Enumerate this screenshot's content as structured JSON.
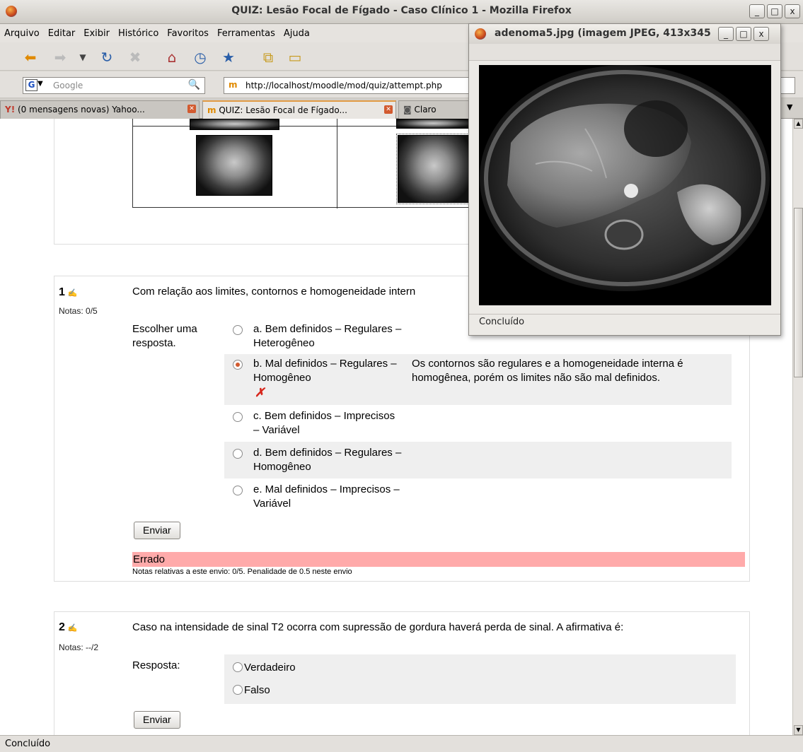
{
  "window": {
    "title": "QUIZ: Lesão Focal de Fígado - Caso Clínico 1 - Mozilla Firefox",
    "min_label": "_",
    "max_label": "□",
    "close_label": "x"
  },
  "menu": [
    "Arquivo",
    "Editar",
    "Exibir",
    "Histórico",
    "Favoritos",
    "Ferramentas",
    "Ajuda"
  ],
  "toolbar": {
    "back_icon": "back-arrow-icon",
    "forward_icon": "forward-arrow-icon",
    "reload_icon": "reload-icon",
    "stop_icon": "stop-icon",
    "home_icon": "home-icon",
    "history_icon": "history-icon",
    "bookmarks_icon": "bookmarks-icon",
    "newtab_icon": "new-tab-icon"
  },
  "nav": {
    "search_engine": "G",
    "search_placeholder": "Google",
    "url": "http://localhost/moodle/mod/quiz/attempt.php"
  },
  "tabs": [
    {
      "label": "(0 mensagens novas) Yahoo...",
      "active": false
    },
    {
      "label": "QUIZ: Lesão Focal de Fígado...",
      "active": true
    },
    {
      "label": "Claro",
      "active": false
    }
  ],
  "question1": {
    "number": "1",
    "notas": "Notas: 0/5",
    "text": "Com relação aos limites, contornos e homogeneidade intern",
    "answer_prompt": "Escolher uma resposta.",
    "options": [
      {
        "label": "a. Bem definidos – Regulares – Heterogêneo",
        "selected": false,
        "feedback": ""
      },
      {
        "label": "b. Mal definidos – Regulares – Homogêneo",
        "selected": true,
        "feedback": "Os contornos são regulares e a homogeneidade interna é homogênea, porém os limites não são mal definidos."
      },
      {
        "label": "c. Bem definidos – Imprecisos – Variável",
        "selected": false,
        "feedback": ""
      },
      {
        "label": "d. Bem definidos – Regulares – Homogêneo",
        "selected": false,
        "feedback": ""
      },
      {
        "label": "e. Mal definidos – Imprecisos – Variável",
        "selected": false,
        "feedback": ""
      }
    ],
    "wrong_mark": "✗",
    "submit_label": "Enviar",
    "result": "Errado",
    "result_note": "Notas relativas a este envio: 0/5. Penalidade de 0.5 neste envio",
    "result_color": "#ffaaaa"
  },
  "question2": {
    "number": "2",
    "notas": "Notas: --/2",
    "text": "Caso na intensidade de sinal T2 ocorra com supressão de gordura haverá perda de sinal. A afirmativa é:",
    "answer_prompt": "Resposta:",
    "options": [
      "Verdadeiro",
      "Falso"
    ],
    "submit_label": "Enviar"
  },
  "popup": {
    "title": "adenoma5.jpg (imagem JPEG, 413x345",
    "status": "Concluído"
  },
  "status": "Concluído",
  "colors": {
    "accent": "#e29b44",
    "error_bg": "#ffaaaa",
    "wrong_x": "#d7261b"
  }
}
